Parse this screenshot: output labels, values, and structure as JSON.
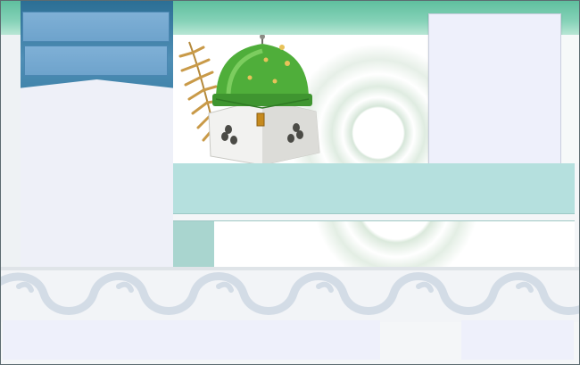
{
  "theme": {
    "header_band": "#6cc6a6",
    "sidebar_head": "#3a7fa6",
    "sidebar_tab": "#74a8d0",
    "teal_bar": "#b5e0de",
    "panel_fill": "#eef0fb",
    "dome_green": "#4fae3a",
    "ornament": "#d3dce6"
  },
  "sidebar": {
    "tabs": [
      {
        "label": ""
      },
      {
        "label": ""
      }
    ]
  },
  "banner": {
    "icons": [
      "mosque-dome-icon",
      "fern-leaf-icon",
      "crescent-finial-icon"
    ]
  },
  "panels": {
    "right_panel_text": "",
    "teal_bar_text": "",
    "footer_left_text": "",
    "footer_right_text": ""
  }
}
